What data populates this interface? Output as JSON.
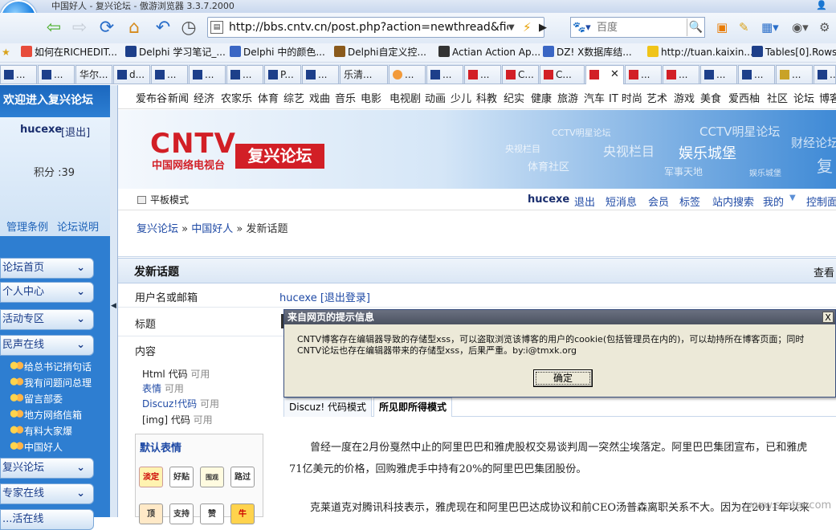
{
  "window": {
    "title": "中国好人 - 复兴论坛 - 傲游浏览器 3.3.7.2000"
  },
  "navigation": {
    "url": "http://bbs.cntv.cn/post.php?action=newthread&fid=309",
    "search_placeholder": "百度"
  },
  "bookmarks": [
    "如何在RICHEDIT...",
    "Delphi 学习笔记_...",
    "Delphi 中的颜色...",
    "Delphi自定义控...",
    "Actian Action Ap...",
    "DZ! X数据库结...",
    "http://tuan.kaixin...",
    "Tables[0].Rows("
  ],
  "tabs": [
    "...",
    "...",
    "华尔...",
    "d...",
    "...",
    "...",
    "...",
    "P...",
    "...",
    "乐清...",
    "...",
    "...",
    "...",
    "C...",
    "C...",
    "",
    "...",
    "...",
    "...",
    "...",
    "...",
    "..."
  ],
  "sidebar": {
    "header": "欢迎进入复兴论坛",
    "username": "hucexe",
    "logout": "[退出]",
    "points": "积分 :39",
    "link_rules": "管理条例",
    "link_help": "论坛说明",
    "menu": [
      "论坛首页",
      "个人中心",
      "活动专区",
      "民声在线",
      "复兴论坛",
      "专家在线",
      "...活在线"
    ],
    "submenu": [
      "给总书记捎句话",
      "我有问题问总理",
      "留言部委",
      "地方网络信箱",
      "有料大家爆",
      "中国好人"
    ]
  },
  "channels": [
    "爱布谷",
    "新闻",
    "经济",
    "农家乐",
    "体育",
    "综艺",
    "戏曲",
    "音乐",
    "电影",
    "电视剧",
    "动画",
    "少儿",
    "科教",
    "纪实",
    "健康",
    "旅游",
    "汽车",
    "IT 时尚",
    "艺术",
    "游戏",
    "美食",
    "爱西柚",
    "社区",
    "论坛",
    "博客"
  ],
  "banner": {
    "logo": "CNTV",
    "logo_sub": "中国网络电视台",
    "forum": "复兴论坛",
    "tags": [
      "CCTV明星论坛",
      "CCTV明星论坛",
      "财经论坛",
      "央视栏目",
      "央视栏目",
      "娱乐城堡",
      "体育社区",
      "军事天地",
      "娱乐城堡",
      "复"
    ]
  },
  "userbar": {
    "mode": "平板模式",
    "user": "hucexe",
    "links": [
      "退出",
      "短消息",
      "会员",
      "标签",
      "站内搜索",
      "我的",
      "控制面"
    ]
  },
  "breadcrumb": {
    "home": "复兴论坛",
    "forum": "中国好人",
    "current": "发新话题"
  },
  "form": {
    "heading": "发新话题",
    "view": "查看",
    "label_user": "用户名或邮箱",
    "user_value": "hucexe [退出登录]",
    "label_subject": "标题",
    "label_content": "内容",
    "codes": [
      {
        "name": "Html 代码",
        "state": "可用"
      },
      {
        "name": "表情",
        "state": "可用"
      },
      {
        "name": "Discuz!代码",
        "state": "可用"
      },
      {
        "name": "[img] 代码",
        "state": "可用"
      }
    ],
    "emoticons_title": "默认表情",
    "emoticons": [
      "淡定",
      "好贴",
      "围观",
      "路过",
      "顶",
      "支持",
      "赞",
      "牛"
    ],
    "mode_tabs": [
      "Discuz! 代码模式",
      "所见即所得模式"
    ],
    "body_lines": [
      "曾经一度在2月份戛然中止的阿里巴巴和雅虎股权交易谈判周一突然尘埃落定。阿里巴巴集团宣布，已和雅虎",
      "71亿美元的价格，回购雅虎手中持有20%的阿里巴巴集团股份。",
      "克莱道克对腾讯科技表示，雅虎现在和阿里巴巴达成协议和前CEO汤普森离职关系不大。因为在2011年以来"
    ]
  },
  "dialog": {
    "title": "来自网页的提示信息",
    "message_line1": "CNTV博客存在编辑器导致的存储型xss，可以盗取浏览该博客的用户的cookie(包括管理员在内的)，可以劫持所在博客页面；同时",
    "message_line2": "CNTV论坛也存在编辑器带来的存储型xss，后果严重。by:i@tmxk.org",
    "ok": "确定",
    "close": "X"
  },
  "watermark": "www.sxstar.com"
}
